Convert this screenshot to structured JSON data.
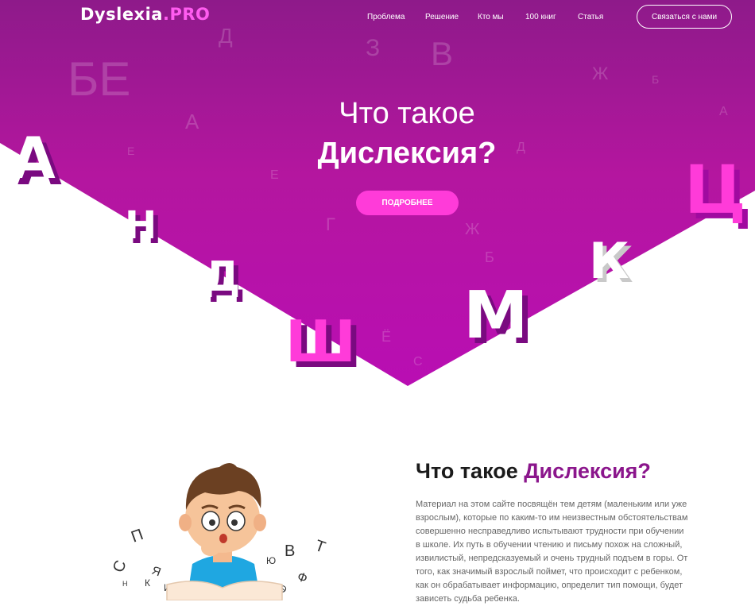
{
  "logo": {
    "main": "Dyslexia",
    "suffix": ".PRO"
  },
  "nav": {
    "items": [
      "Проблема",
      "Решение",
      "Кто мы",
      "100 книг",
      "Статья"
    ],
    "contact_label": "Связаться с нами"
  },
  "hero": {
    "title_line1": "Что такое",
    "title_line2": "Дислексия?",
    "button_label": "ПОДРОБНЕЕ",
    "letters": [
      "А",
      "Н",
      "Д",
      "Ш",
      "М",
      "К",
      "Ц"
    ],
    "bg_letters": [
      "Б",
      "Е",
      "В",
      "Д",
      "Ж",
      "Г",
      "З"
    ]
  },
  "about": {
    "title_prefix": "Что такое ",
    "title_accent": "Дислексия?",
    "text": "Материал на этом сайте посвящён тем детям (маленьким или уже взрослым), которые по каким-то им неизвестным обстоятельствам совершенно несправедливо испытывают трудности при обучении в школе. Их путь в обучении чтению и письму похож на сложный, извилистый, непредсказуемый и очень трудный подъем в горы. От того, как значимый взрослый поймет, что происходит с ребенком, как он обрабатывает информацию, определит тип помощи, будет зависеть судьба ребенка."
  },
  "illustration": {
    "floating_letters": [
      "П",
      "С",
      "Я",
      "К",
      "И",
      "Н",
      "Ю",
      "В",
      "Т",
      "Э",
      "Ф"
    ]
  },
  "colors": {
    "hero_top": "#b0239e",
    "hero_bottom": "#a010a0",
    "accent": "#8b168c",
    "button": "#ff3bd9",
    "logo_pro": "#ff5cf0"
  }
}
